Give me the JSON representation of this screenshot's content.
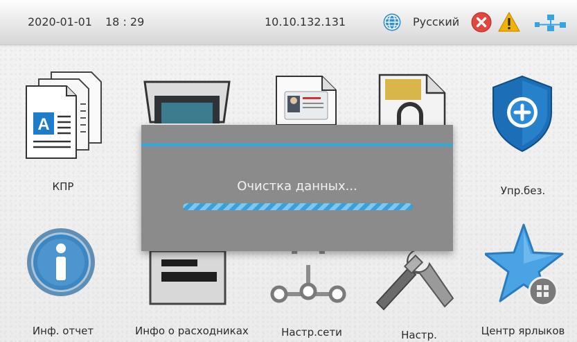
{
  "status_bar": {
    "date": "2020-01-01",
    "time": "18 : 29",
    "ip": "10.10.132.131",
    "language": "Русский",
    "icons": [
      "globe-icon",
      "error-icon",
      "warning-icon",
      "network-icon"
    ]
  },
  "tiles": [
    {
      "label": "КПР",
      "icon": "copy-document-icon"
    },
    {
      "label": "",
      "icon": "scanner-icon"
    },
    {
      "label": "",
      "icon": "id-card-copy-icon"
    },
    {
      "label": "",
      "icon": "secure-document-icon"
    },
    {
      "label": "Упр.без.",
      "icon": "security-shield-icon"
    },
    {
      "label": "Инф. отчет",
      "icon": "info-icon"
    },
    {
      "label": "Инфо о расходниках",
      "icon": "toner-cartridge-icon"
    },
    {
      "label": "Настр.сети",
      "icon": "network-settings-icon"
    },
    {
      "label": "Настр.",
      "icon": "tools-icon"
    },
    {
      "label": "Центр ярлыков",
      "icon": "shortcut-center-icon"
    }
  ],
  "dialog": {
    "message": "Очистка данных...",
    "progress": 1.0
  },
  "colors": {
    "accent": "#2eaae1",
    "dialog_bg": "#8b8b8b",
    "error": "#e2463f",
    "warning": "#f0b000"
  }
}
